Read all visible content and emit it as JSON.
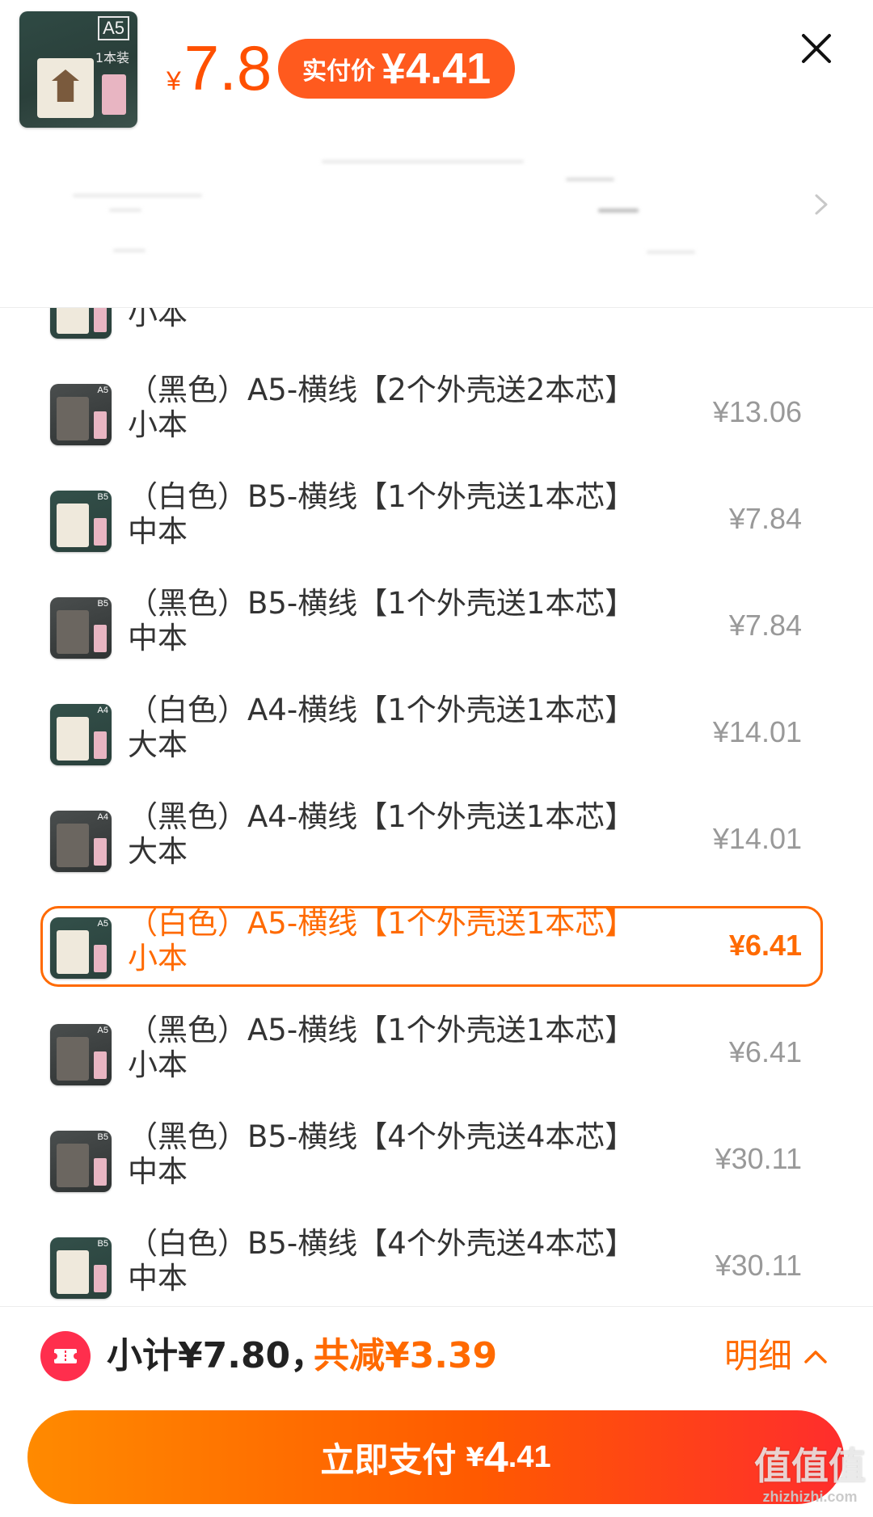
{
  "header": {
    "product_size_tag": "A5",
    "product_pack_label": "1本装",
    "yen_symbol": "¥",
    "price": "7.8",
    "real_pay_label": "实付价",
    "real_pay_value": "¥4.41",
    "close_icon": "close-icon",
    "arrow_icon": "chevron-right-icon"
  },
  "skus": [
    {
      "name": "（黑色）A5-横线【2个外壳送2本芯】",
      "size": "小本",
      "price": "¥13.06",
      "color": "black",
      "tag": "A5",
      "selected": false
    },
    {
      "name": "（白色）B5-横线【1个外壳送1本芯】",
      "size": "中本",
      "price": "¥7.84",
      "color": "white",
      "tag": "B5",
      "selected": false
    },
    {
      "name": "（黑色）B5-横线【1个外壳送1本芯】",
      "size": "中本",
      "price": "¥7.84",
      "color": "black",
      "tag": "B5",
      "selected": false
    },
    {
      "name": "（白色）A4-横线【1个外壳送1本芯】",
      "size": "大本",
      "price": "¥14.01",
      "color": "white",
      "tag": "A4",
      "selected": false
    },
    {
      "name": "（黑色）A4-横线【1个外壳送1本芯】",
      "size": "大本",
      "price": "¥14.01",
      "color": "black",
      "tag": "A4",
      "selected": false
    },
    {
      "name": "（白色）A5-横线【1个外壳送1本芯】",
      "size": "小本",
      "price": "¥6.41",
      "color": "white",
      "tag": "A5",
      "selected": true
    },
    {
      "name": "（黑色）A5-横线【1个外壳送1本芯】",
      "size": "小本",
      "price": "¥6.41",
      "color": "black",
      "tag": "A5",
      "selected": false
    },
    {
      "name": "（黑色）B5-横线【4个外壳送4本芯】",
      "size": "中本",
      "price": "¥30.11",
      "color": "black",
      "tag": "B5",
      "selected": false
    },
    {
      "name": "（白色）B5-横线【4个外壳送4本芯】",
      "size": "中本",
      "price": "¥30.11",
      "color": "white",
      "tag": "B5",
      "selected": false
    }
  ],
  "partial_top_row": {
    "size": "小本"
  },
  "footer": {
    "subtotal": "小计¥7.80，",
    "discount": "共减¥3.39",
    "detail_label": "明细",
    "pay_label": "立即支付",
    "pay_yen": "¥",
    "pay_int": "4",
    "pay_dec": ".41",
    "accent_color": "#ff6a00"
  },
  "watermark": {
    "main": "值值值",
    "sub": "zhizhizhi.com"
  }
}
